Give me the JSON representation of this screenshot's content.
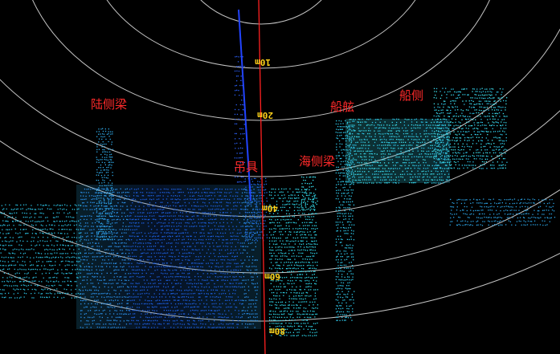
{
  "annotations": {
    "land_side_beam": "陆侧梁",
    "spreader": "吊具",
    "sea_side_beam": "海侧梁",
    "ship_hatch": "船舷",
    "ship_side": "船侧"
  },
  "range_rings": {
    "labels": [
      "10m",
      "20m",
      "40m",
      "60m",
      "80m"
    ]
  },
  "colors": {
    "background": "#000000",
    "range_ring": "#e6e6e6",
    "range_label": "#ffd21a",
    "center_axis": "#ff2020",
    "vertical_axis": "#2244ff",
    "annotation": "#ff2a2a",
    "points_blue": "#1f6fe0",
    "points_cyan": "#35e0ee"
  }
}
